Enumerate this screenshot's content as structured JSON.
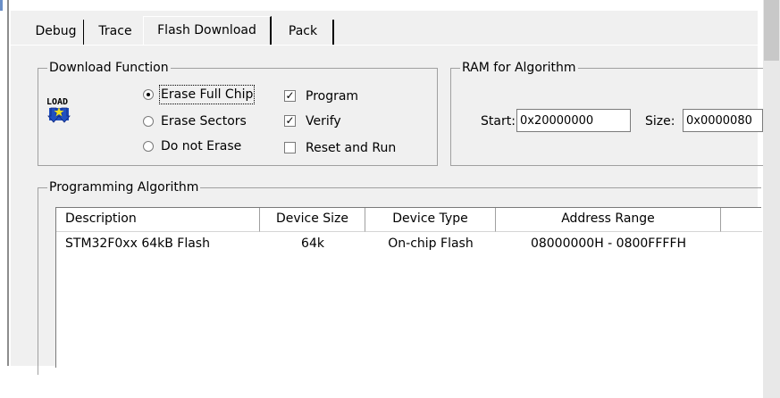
{
  "tabs": [
    {
      "label": "Debug"
    },
    {
      "label": "Trace"
    },
    {
      "label": "Flash Download"
    },
    {
      "label": "Pack"
    }
  ],
  "active_tab": "Flash Download",
  "download_function": {
    "title": "Download Function",
    "icon_text": "LOAD",
    "erase_options": [
      {
        "label": "Erase Full Chip",
        "selected": true
      },
      {
        "label": "Erase Sectors",
        "selected": false
      },
      {
        "label": "Do not Erase",
        "selected": false
      }
    ],
    "checkboxes": [
      {
        "label": "Program",
        "checked": true
      },
      {
        "label": "Verify",
        "checked": true
      },
      {
        "label": "Reset and Run",
        "checked": false
      }
    ]
  },
  "ram_for_algorithm": {
    "title": "RAM for Algorithm",
    "start_label": "Start:",
    "start_value": "0x20000000",
    "size_label": "Size:",
    "size_value": "0x0000080"
  },
  "programming_algorithm": {
    "title": "Programming Algorithm",
    "columns": [
      "Description",
      "Device Size",
      "Device Type",
      "Address Range"
    ],
    "rows": [
      {
        "description": "STM32F0xx 64kB Flash",
        "device_size": "64k",
        "device_type": "On-chip Flash",
        "address_range": "08000000H - 0800FFFFH"
      }
    ]
  },
  "colors": {
    "panel": "#f0f0f0",
    "border": "#a0a0a0",
    "icon_blue": "#2050c0",
    "icon_yellow": "#f0e020"
  }
}
